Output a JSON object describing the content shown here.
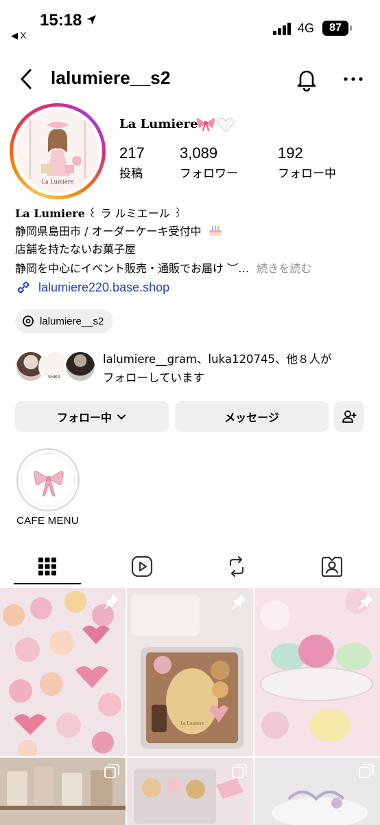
{
  "status_bar": {
    "time": "15:18",
    "back_app": "◀ X",
    "network": "4G",
    "battery": "87"
  },
  "header": {
    "username": "lalumiere__s2",
    "back_icon": "chevron-left-icon",
    "bell_icon": "bell-icon",
    "more_icon": "ellipsis-icon"
  },
  "profile": {
    "avatar_brand": "La Lumiere",
    "display_name": "La Lumiere",
    "stats": [
      {
        "value": "217",
        "label": "投稿"
      },
      {
        "value": "3,089",
        "label": "フォロワー"
      },
      {
        "value": "192",
        "label": "フォロー中"
      }
    ],
    "bio": {
      "line1_name": "La Lumiere",
      "line1_rest": " ꒰ ラ ルミエール ꒱",
      "line2": "静岡県島田市 / オーダーケーキ受付中",
      "line3": "店舗を持たないお菓子屋",
      "line4": "静岡を中心にイベント販売・通販でお届け ︶…",
      "more": "続きを読む"
    },
    "link": "lalumiere220.base.shop",
    "threads": "lalumiere__s2",
    "mutual": {
      "line1": "lalumiere__gram、luka120745、他８人が",
      "line2": "フォローしています",
      "avatar_caption": "SHIKA"
    }
  },
  "actions": {
    "following": "フォロー中",
    "message": "メッセージ",
    "add_person_icon": "add-person-icon"
  },
  "highlights": [
    {
      "label": "CAFE MENU"
    }
  ],
  "tabs": [
    {
      "icon": "grid-icon",
      "active": true
    },
    {
      "icon": "reels-icon",
      "active": false
    },
    {
      "icon": "repost-icon",
      "active": false
    },
    {
      "icon": "tagged-icon",
      "active": false
    }
  ],
  "grid_posts": [
    {
      "subject": "pink heart and rose chocolates",
      "badge": "pin-icon"
    },
    {
      "subject": "cookie tin with La Lumiere cookie",
      "badge": "pin-icon",
      "cookie_text": "La Lumiere"
    },
    {
      "subject": "macarons on glass stand",
      "badge": "pin-icon"
    },
    {
      "subject": "jars on shelf",
      "badge": "multi-icon"
    },
    {
      "subject": "bear cookies in box",
      "badge": "multi-icon"
    },
    {
      "subject": "white cake with decoration",
      "badge": "multi-icon"
    }
  ]
}
